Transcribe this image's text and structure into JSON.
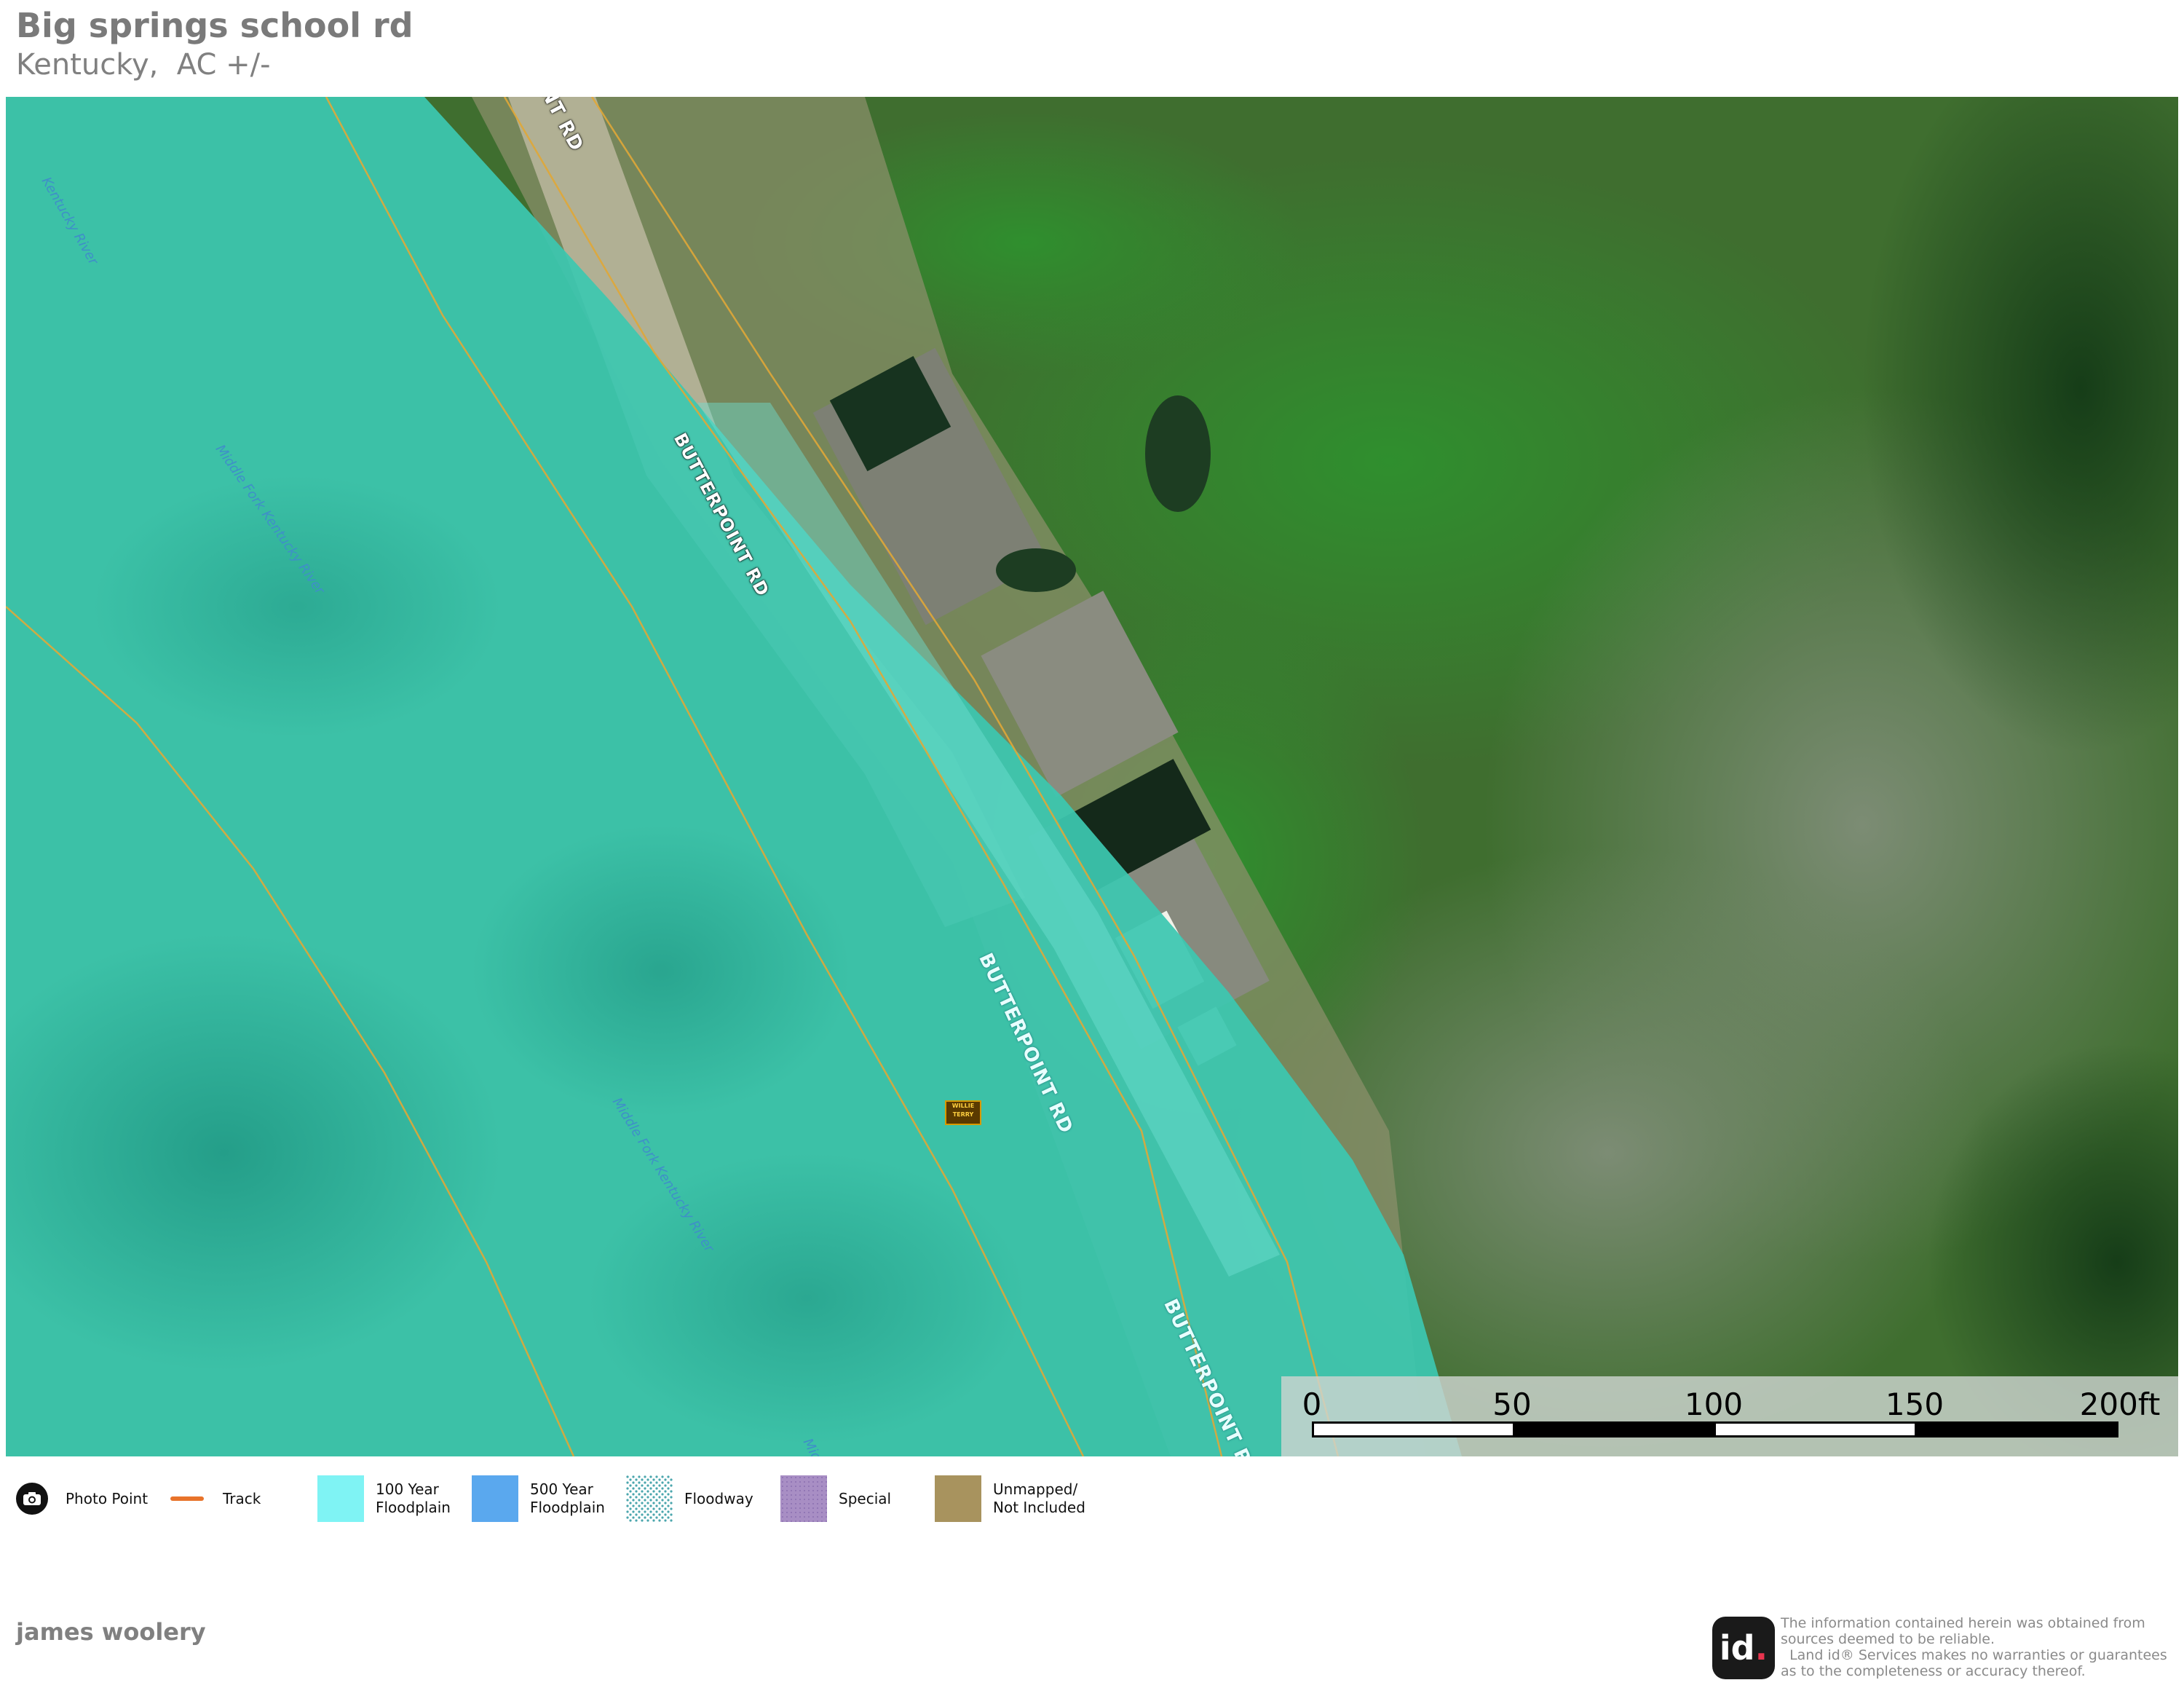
{
  "header": {
    "title": "Big springs school rd",
    "subtitle": "Kentucky,  AC +/-"
  },
  "map": {
    "road_labels": [
      "NT RD",
      "BUTTERPOINT RD",
      "BUTTERPOINT RD",
      "BUTTERPOINT RD"
    ],
    "river_labels": [
      "Kentucky River",
      "Middle Fork Kentucky River",
      "Middle Fork Kentucky River",
      "Middle Fork Kent"
    ],
    "marker_text": [
      "WILLIE",
      "TERRY"
    ],
    "floodplain_color": "#3cc7b0"
  },
  "scale": {
    "ticks": [
      "0",
      "50",
      "100",
      "150",
      "200ft"
    ]
  },
  "legend": {
    "items": [
      {
        "label": "Photo Point",
        "icon": "camera-icon"
      },
      {
        "label": "Track",
        "color": "#e8732a"
      },
      {
        "label": "100 Year\nFloodplain",
        "color": "#7ff3f4"
      },
      {
        "label": "500 Year\nFloodplain",
        "color": "#5aa8ee"
      },
      {
        "label": "Floodway",
        "color": "#9fd2d6"
      },
      {
        "label": "Special",
        "color": "#a88ec4"
      },
      {
        "label": "Unmapped/\nNot Included",
        "color": "#a8935e"
      }
    ]
  },
  "footer": {
    "author": "james woolery",
    "logo_text": "id",
    "disclaimer": [
      "The information contained herein was obtained from",
      "sources deemed to be reliable.",
      "  Land id® Services makes no warranties or guarantees",
      "as to the completeness or accuracy thereof."
    ]
  }
}
